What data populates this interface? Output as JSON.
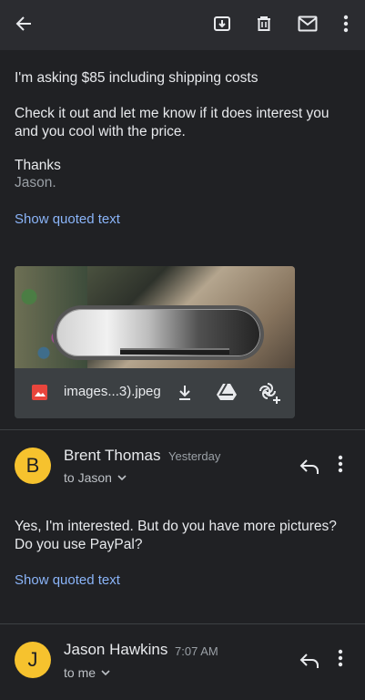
{
  "toolbar": {
    "back_icon": "arrow-left-icon",
    "archive_icon": "archive-icon",
    "delete_icon": "trash-icon",
    "mark_unread_icon": "mail-icon",
    "more_icon": "more-vert-icon"
  },
  "message1": {
    "line1": "I'm asking $85 including shipping costs",
    "line2a": "Check it out and let me know if it does interest you",
    "line2b": "and you cool with the price.",
    "thanks": "Thanks",
    "signature": "Jason.",
    "show_quoted": "Show quoted text",
    "attachment": {
      "file_name": "images...3).jpeg",
      "type_icon": "image-icon",
      "download_icon": "download-icon",
      "drive_icon": "drive-icon",
      "photos_icon": "photos-add-icon"
    }
  },
  "message2": {
    "avatar_letter": "B",
    "sender": "Brent Thomas",
    "time": "Yesterday",
    "to": "to Jason",
    "body_line1": "Yes, I'm interested. But do you have more pictures?",
    "body_line2": "Do you use PayPal?",
    "show_quoted": "Show quoted text",
    "reply_icon": "reply-icon",
    "more_icon": "more-vert-icon"
  },
  "message3": {
    "avatar_letter": "J",
    "sender": "Jason Hawkins",
    "time": "7:07 AM",
    "to": "to me",
    "reply_icon": "reply-icon",
    "more_icon": "more-vert-icon"
  },
  "colors": {
    "background": "#202124",
    "toolbar": "#2b2c30",
    "link": "#8ab4f8",
    "avatar": "#f6c22e"
  }
}
